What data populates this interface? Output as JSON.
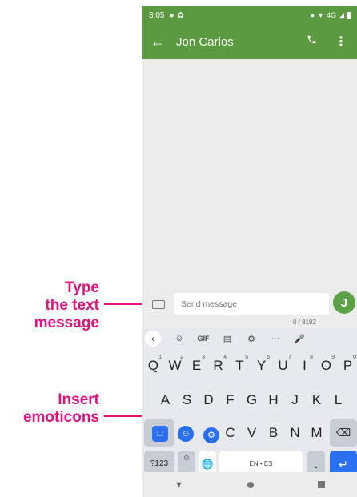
{
  "callouts": {
    "type_text": [
      "Type",
      "the text",
      "message"
    ],
    "insert_emoticons": [
      "Insert",
      "emoticons"
    ]
  },
  "status_bar": {
    "time": "3:05",
    "network": "4G"
  },
  "app_bar": {
    "title": "Jon Carlos"
  },
  "compose": {
    "placeholder": "Send message",
    "char_count": "0 / 8192",
    "avatar_letter": "J"
  },
  "keyboard": {
    "toolbar": {
      "gif": "GIF",
      "more": "···"
    },
    "row1": [
      "Q",
      "W",
      "E",
      "R",
      "T",
      "Y",
      "U",
      "I",
      "O",
      "P"
    ],
    "row1_hints": [
      "1",
      "2",
      "3",
      "4",
      "5",
      "6",
      "7",
      "8",
      "9",
      "0"
    ],
    "row2": [
      "A",
      "S",
      "D",
      "F",
      "G",
      "H",
      "J",
      "K",
      "L"
    ],
    "row3": [
      "C",
      "V",
      "B",
      "N",
      "M"
    ],
    "symbols_key": "?123",
    "space_label": "EN • ES",
    "period_key": "."
  },
  "colors": {
    "header_green": "#5b9a41",
    "callout_magenta": "#e2137d",
    "avatar_green": "#5ba246"
  }
}
